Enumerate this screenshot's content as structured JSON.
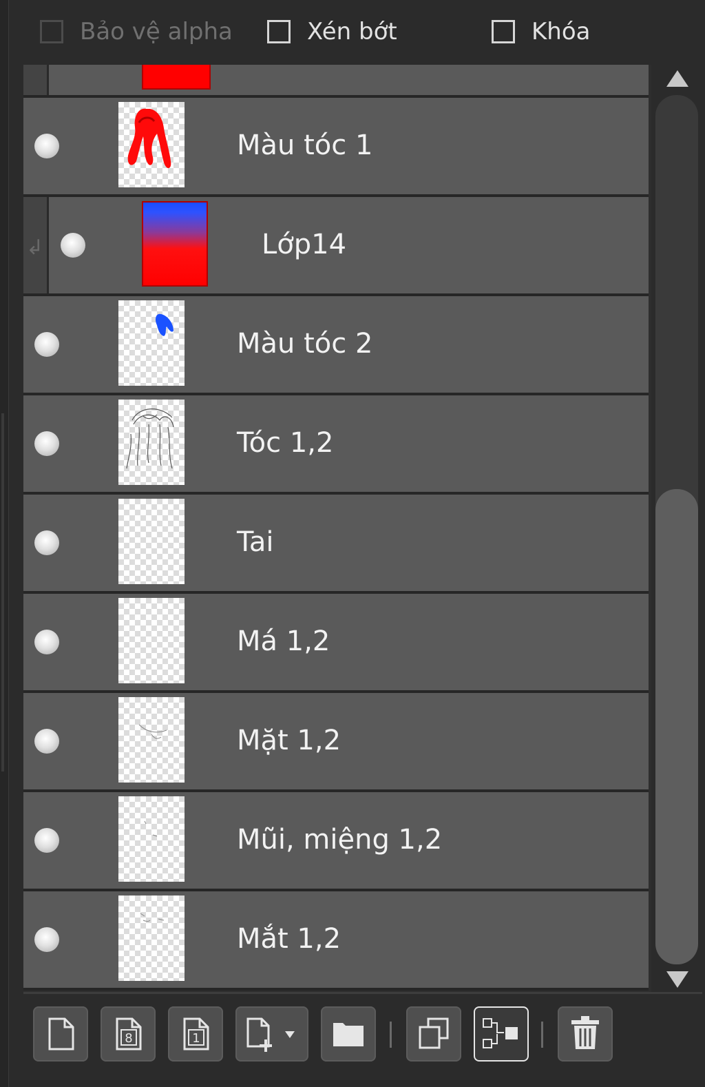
{
  "options": {
    "protect_alpha_label": "Bảo vệ alpha",
    "clip_label": "Xén bớt",
    "lock_label": "Khóa"
  },
  "layers": [
    {
      "name": "Màu tóc 1",
      "thumb": "red-hair"
    },
    {
      "name": "Lớp14",
      "thumb": "blue-red-gradient",
      "clipped": true
    },
    {
      "name": "Màu tóc 2",
      "thumb": "blue-stroke"
    },
    {
      "name": "Tóc 1,2",
      "thumb": "sketch"
    },
    {
      "name": "Tai",
      "thumb": "empty"
    },
    {
      "name": "Má 1,2",
      "thumb": "empty"
    },
    {
      "name": "Mặt 1,2",
      "thumb": "faint"
    },
    {
      "name": "Mũi, miệng 1,2",
      "thumb": "faint"
    },
    {
      "name": "Mắt 1,2",
      "thumb": "faint"
    }
  ],
  "icons": {
    "new_layer": "new-layer-icon",
    "new_8bit_layer": "new-8bit-layer-icon",
    "new_1bit_layer": "new-1bit-layer-icon",
    "add_from_file": "add-from-file-icon",
    "new_folder": "folder-icon",
    "duplicate": "duplicate-icon",
    "merge": "merge-icon",
    "delete": "trash-icon"
  },
  "colors": {
    "panel_bg": "#2b2b2b",
    "layer_row": "#5a5a5a",
    "text": "#f2f2f2",
    "red": "#ff0000",
    "blue": "#1a4cff"
  }
}
